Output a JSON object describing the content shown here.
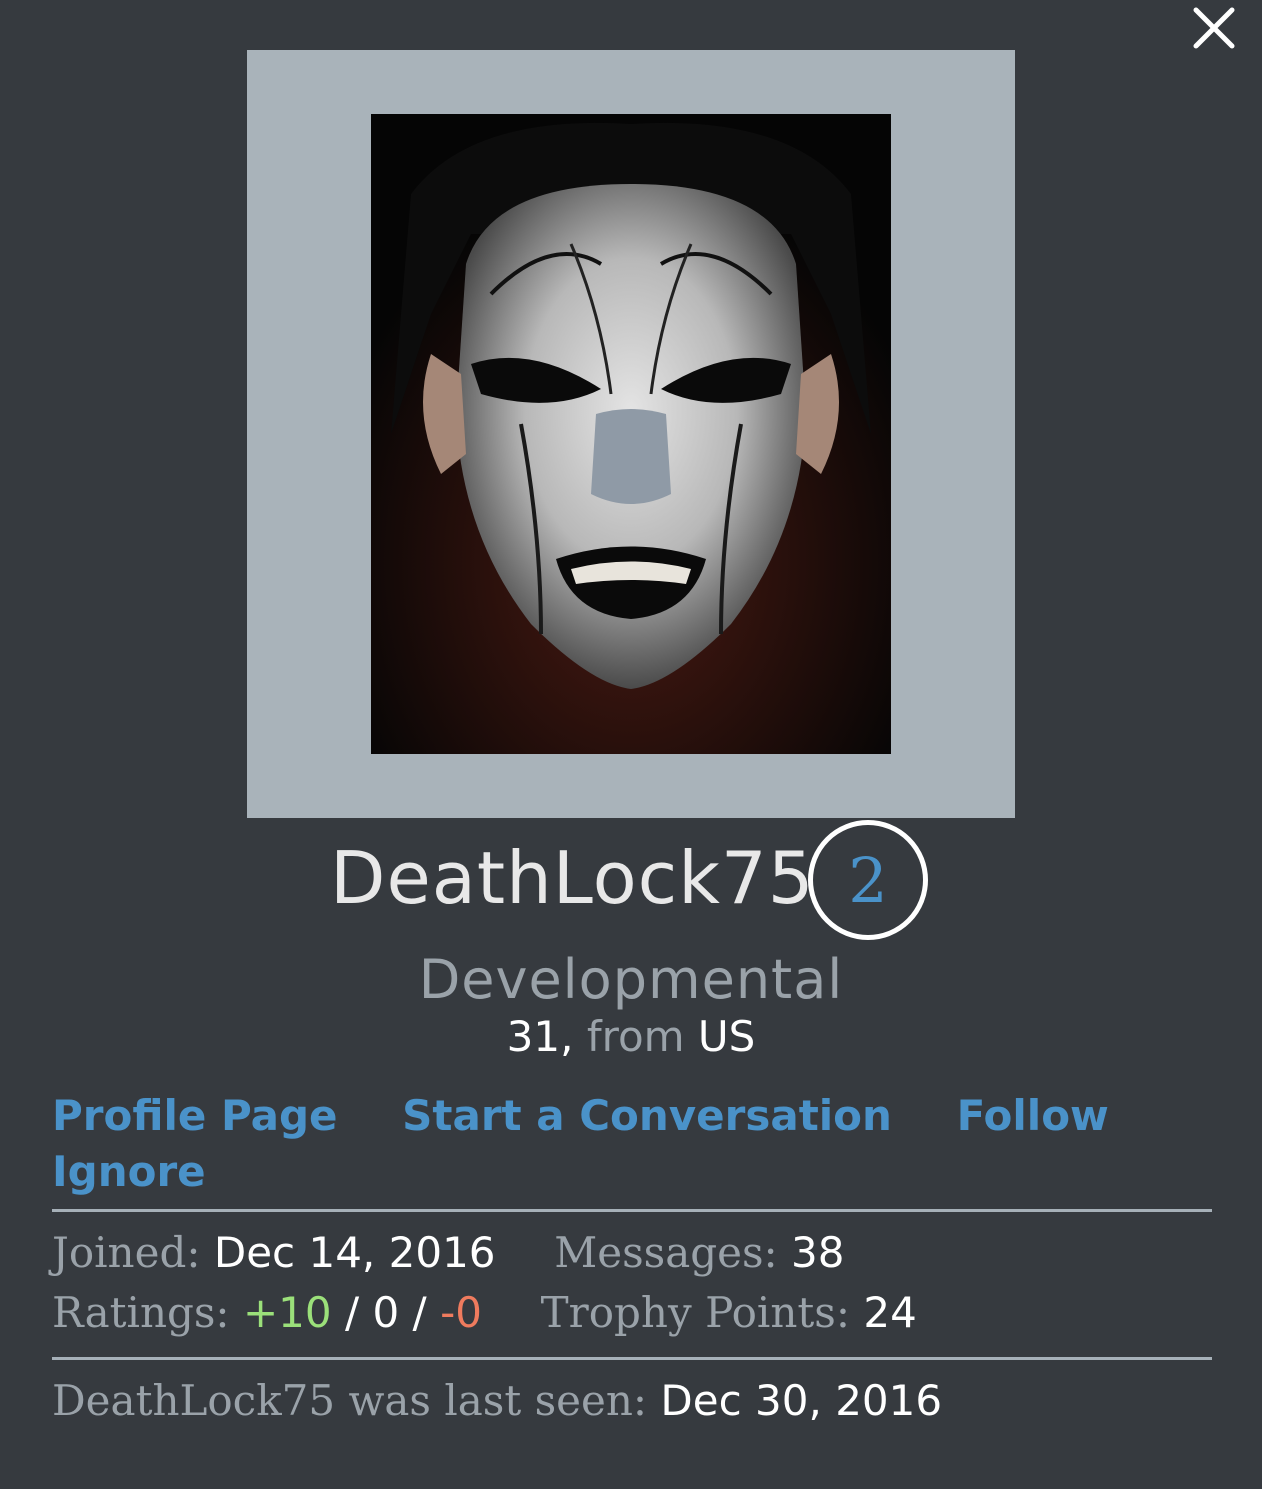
{
  "close_icon": "close-icon",
  "user": {
    "name": "DeathLock75",
    "badge_count": "2",
    "rank": "Developmental",
    "age": "31,",
    "from_label": "from",
    "location": "US"
  },
  "links": {
    "profile": "Profile Page",
    "conversation": "Start a Conversation",
    "follow": "Follow",
    "ignore": "Ignore"
  },
  "stats": {
    "joined_label": "Joined:",
    "joined_value": "Dec 14, 2016",
    "messages_label": "Messages:",
    "messages_value": "38",
    "ratings_label": "Ratings:",
    "ratings_positive": "+10",
    "ratings_sep1": "/",
    "ratings_neutral": "0",
    "ratings_sep2": "/",
    "ratings_negative": "-0",
    "trophy_label": "Trophy Points:",
    "trophy_value": "24"
  },
  "last_seen": {
    "label": "DeathLock75 was last seen:",
    "value": "Dec 30, 2016"
  },
  "colors": {
    "background": "#363a3f",
    "link": "#4a92c9",
    "muted": "#9aa2a9",
    "positive": "#9be07a",
    "negative": "#ef7b5e",
    "avatar_frame": "#a9b3ba"
  }
}
